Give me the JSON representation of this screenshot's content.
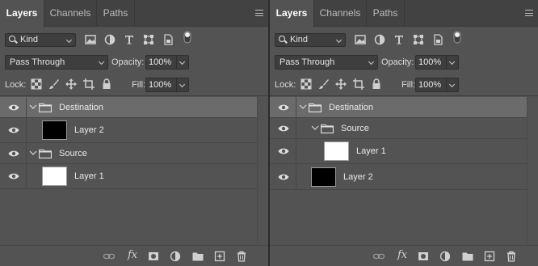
{
  "panels": [
    {
      "tabs": [
        "Layers",
        "Channels",
        "Paths"
      ],
      "filter": {
        "kind_label": "Kind"
      },
      "blend": {
        "mode": "Pass Through",
        "opacity_label": "Opacity:",
        "opacity_value": "100%"
      },
      "lock": {
        "label": "Lock:",
        "fill_label": "Fill:",
        "fill_value": "100%"
      },
      "layers": [
        {
          "name": "Destination",
          "kind": "group",
          "depth": 0,
          "selected": true
        },
        {
          "name": "Layer 2",
          "kind": "layer",
          "depth": 1,
          "thumb_color": "#000000"
        },
        {
          "name": "Source",
          "kind": "group",
          "depth": 0
        },
        {
          "name": "Layer 1",
          "kind": "layer",
          "depth": 1,
          "thumb_color": "#ffffff"
        }
      ]
    },
    {
      "tabs": [
        "Layers",
        "Channels",
        "Paths"
      ],
      "filter": {
        "kind_label": "Kind"
      },
      "blend": {
        "mode": "Pass Through",
        "opacity_label": "Opacity:",
        "opacity_value": "100%"
      },
      "lock": {
        "label": "Lock:",
        "fill_label": "Fill:",
        "fill_value": "100%"
      },
      "layers": [
        {
          "name": "Destination",
          "kind": "group",
          "depth": 0,
          "selected": true
        },
        {
          "name": "Source",
          "kind": "group",
          "depth": 1
        },
        {
          "name": "Layer 1",
          "kind": "layer",
          "depth": 2,
          "thumb_color": "#ffffff"
        },
        {
          "name": "Layer 2",
          "kind": "layer",
          "depth": 1,
          "thumb_color": "#000000"
        }
      ]
    }
  ],
  "footer_icons": [
    "link-icon",
    "fx-icon",
    "mask-icon",
    "adjustment-icon",
    "folder-icon",
    "new-layer-icon",
    "trash-icon"
  ],
  "colors": {
    "panel_bg": "#535353",
    "tab_bar_bg": "#424242",
    "selected_row": "#6b6b6b",
    "divider": "#2b2b2b"
  }
}
